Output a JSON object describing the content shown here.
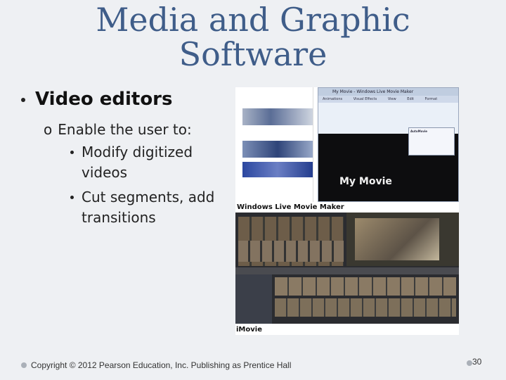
{
  "slide": {
    "title_line1": "Media and Graphic",
    "title_line2": "Software",
    "bullet": "Video editors",
    "sub_marker": "o",
    "sub": "Enable the user to:",
    "items": [
      "Modify digitized videos",
      "Cut segments, add transitions"
    ]
  },
  "figure": {
    "wlmm_window_title": "My Movie - Windows Live Movie Maker",
    "wlmm_tabs": [
      "Animations",
      "Visual Effects",
      "View",
      "Edit",
      "Format"
    ],
    "tooltip_title": "AutoMovie",
    "preview_text": "My Movie",
    "caption_top": "Windows Live Movie Maker",
    "caption_bottom": "iMovie"
  },
  "footer": {
    "copyright": "Copyright © 2012 Pearson Education, Inc. Publishing as Prentice Hall",
    "page_number": "30"
  }
}
